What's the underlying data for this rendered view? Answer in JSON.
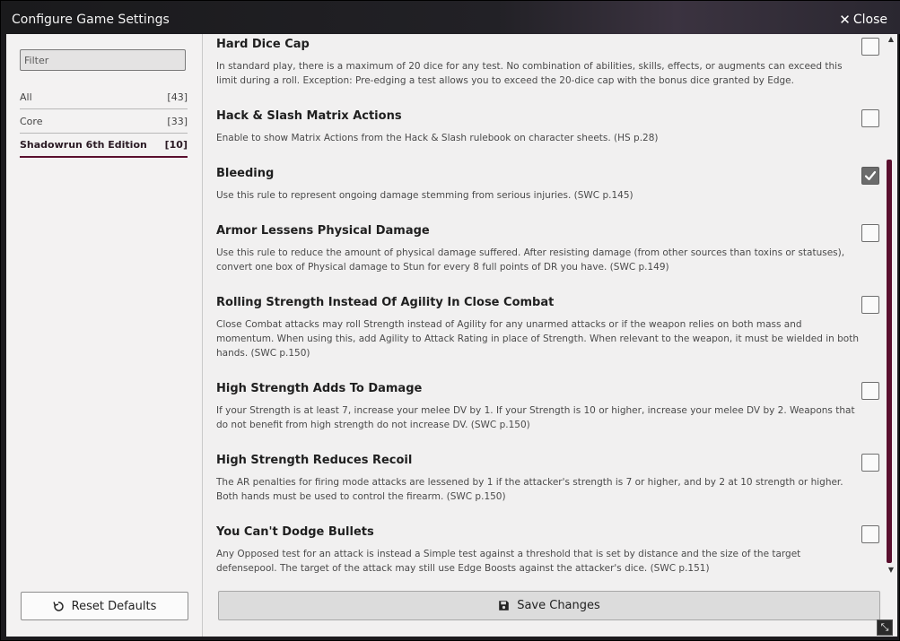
{
  "window": {
    "title": "Configure Game Settings",
    "close_label": "Close"
  },
  "sidebar": {
    "filter_placeholder": "Filter",
    "categories": [
      {
        "label": "All",
        "count": "[43]"
      },
      {
        "label": "Core",
        "count": "[33]"
      },
      {
        "label": "Shadowrun 6th Edition",
        "count": "[10]"
      }
    ],
    "reset_label": "Reset Defaults"
  },
  "settings": [
    {
      "name": "Hard Dice Cap",
      "desc": "In standard play, there is a maximum of 20 dice for any test. No combination of abilities, skills, effects, or augments can exceed this limit during a roll. Exception: Pre-edging a test allows you to exceed the 20-dice cap with the bonus dice granted by Edge.",
      "checked": false
    },
    {
      "name": "Hack & Slash Matrix Actions",
      "desc": "Enable to show Matrix Actions from the Hack & Slash rulebook on character sheets. (HS p.28)",
      "checked": false
    },
    {
      "name": "Bleeding",
      "desc": "Use this rule to represent ongoing damage stemming from serious injuries. (SWC p.145)",
      "checked": true
    },
    {
      "name": "Armor Lessens Physical Damage",
      "desc": "Use this rule to reduce the amount of physical damage suffered. After resisting damage (from other sources than toxins or statuses), convert one box of Physical damage to Stun for every 8 full points of DR you have. (SWC p.149)",
      "checked": false
    },
    {
      "name": "Rolling Strength Instead Of Agility In Close Combat",
      "desc": "Close Combat attacks may roll Strength instead of Agility for any unarmed attacks or if the weapon relies on both mass and momentum. When using this, add Agility to Attack Rating in place of Strength. When relevant to the weapon, it must be wielded in both hands. (SWC p.150)",
      "checked": false
    },
    {
      "name": "High Strength Adds To Damage",
      "desc": "If your Strength is at least 7, increase your melee DV by 1. If your Strength is 10 or higher, increase your melee DV by 2. Weapons that do not benefit from high strength do not increase DV. (SWC p.150)",
      "checked": false
    },
    {
      "name": "High Strength Reduces Recoil",
      "desc": "The AR penalties for firing mode attacks are lessened by 1 if the attacker's strength is 7 or higher, and by 2 at 10 strength or higher. Both hands must be used to control the firearm. (SWC p.150)",
      "checked": false
    },
    {
      "name": "You Can't Dodge Bullets",
      "desc": "Any Opposed test for an attack is instead a Simple test against a threshold that is set by distance and the size of the target defensepool. The target of the attack may still use Edge Boosts against the attacker's dice. (SWC p.151)",
      "checked": false
    }
  ],
  "footer": {
    "save_label": "Save Changes"
  }
}
